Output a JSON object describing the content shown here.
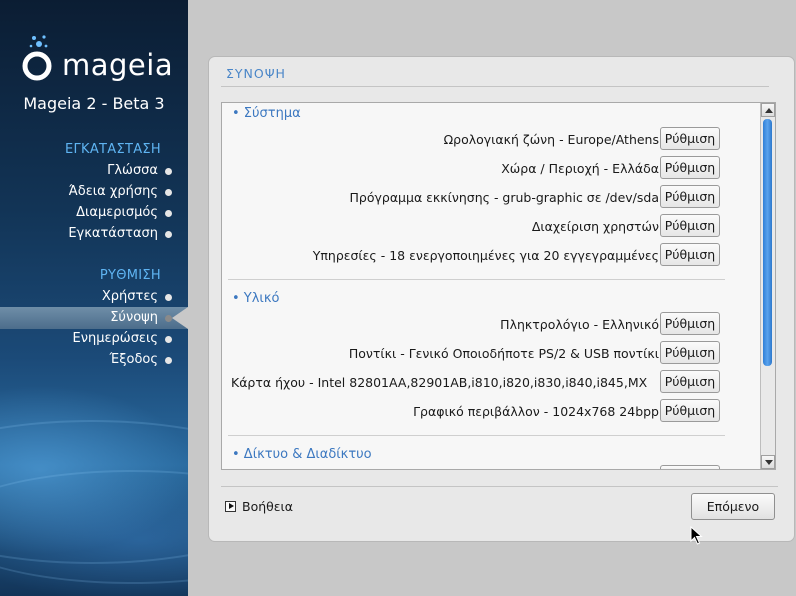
{
  "sidebar": {
    "logo_text": "mageia",
    "product": "Mageia 2 - Beta 3",
    "sections": [
      {
        "title": "ΕΓΚΑΤΑΣΤΑΣΗ",
        "steps": [
          "Γλώσσα",
          "Άδεια χρήσης",
          "Διαμερισμός",
          "Εγκατάσταση"
        ]
      },
      {
        "title": "ΡΥΘΜΙΣΗ",
        "steps": [
          "Χρήστες",
          "Σύνοψη",
          "Ενημερώσεις",
          "Έξοδος"
        ]
      }
    ],
    "active_step": "Σύνοψη"
  },
  "panel": {
    "title": "ΣΥΝΟΨΗ",
    "groups": [
      {
        "name": "• Σύστημα",
        "rows": [
          {
            "label": "Ωρολογιακή ζώνη - Europe/Athens",
            "button": "Ρύθμιση"
          },
          {
            "label": "Χώρα / Περιοχή - Ελλάδα",
            "button": "Ρύθμιση"
          },
          {
            "label": "Πρόγραμμα εκκίνησης - grub-graphic σε /dev/sda",
            "button": "Ρύθμιση"
          },
          {
            "label": "Διαχείριση χρηστών",
            "button": "Ρύθμιση"
          },
          {
            "label": "Υπηρεσίες - 18 ενεργοποιημένες για 20 εγγεγραμμένες",
            "button": "Ρύθμιση"
          }
        ]
      },
      {
        "name": "• Υλικό",
        "rows": [
          {
            "label": "Πληκτρολόγιο - Ελληνικό",
            "button": "Ρύθμιση"
          },
          {
            "label": "Ποντίκι - Γενικό Οποιοδήποτε PS/2 & USB ποντίκι",
            "button": "Ρύθμιση"
          },
          {
            "label": "Κάρτα ήχου - Intel 82801AA,82901AB,i810,i820,i830,i840,i845,MX",
            "button": "Ρύθμιση"
          },
          {
            "label": "Γραφικό περιβάλλον - 1024x768 24bpp",
            "button": "Ρύθμιση"
          }
        ]
      },
      {
        "name": "• Δίκτυο & Διαδίκτυο",
        "rows": []
      }
    ],
    "help_label": "Βοήθεια",
    "next_label": "Επόμενο"
  },
  "colors": {
    "accent": "#4a86c8",
    "sidebar_section": "#5fb4f2",
    "scroll_thumb": "#3a8ae0"
  }
}
